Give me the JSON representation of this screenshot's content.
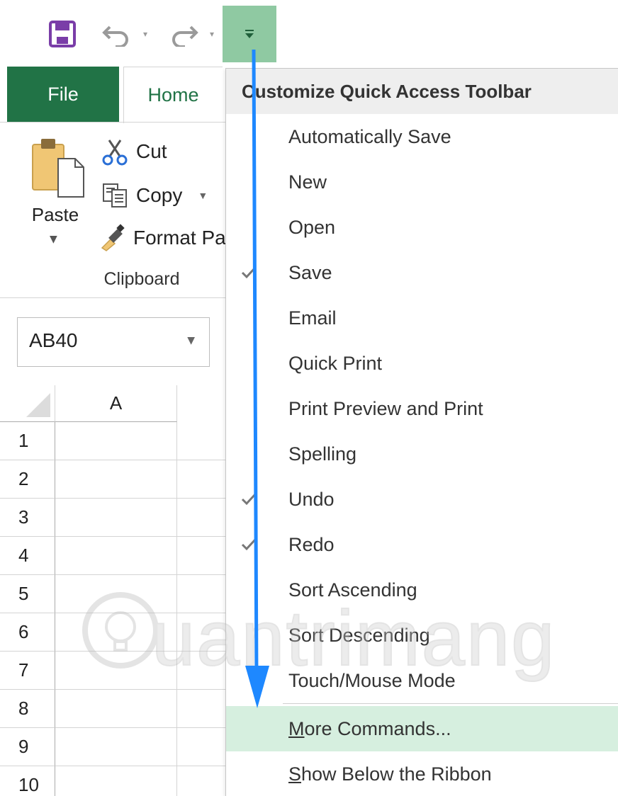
{
  "quick_access": {
    "save_icon": "save-floppy-icon",
    "undo_icon": "undo-icon",
    "redo_icon": "redo-icon",
    "customize_icon": "customize-qat-dropdown-icon"
  },
  "ribbon": {
    "tabs": [
      {
        "label": "File"
      },
      {
        "label": "Home"
      }
    ],
    "clipboard": {
      "paste_label": "Paste",
      "cut_label": "Cut",
      "copy_label": "Copy",
      "format_label": "Format Painter",
      "group_label": "Clipboard"
    }
  },
  "name_box": {
    "value": "AB40"
  },
  "sheet": {
    "columns": [
      "A"
    ],
    "rows": [
      "1",
      "2",
      "3",
      "4",
      "5",
      "6",
      "7",
      "8",
      "9",
      "10"
    ]
  },
  "menu": {
    "title": "Customize Quick Access Toolbar",
    "items": [
      {
        "label": "Automatically Save",
        "checked": false
      },
      {
        "label": "New",
        "checked": false
      },
      {
        "label": "Open",
        "checked": false
      },
      {
        "label": "Save",
        "checked": true
      },
      {
        "label": "Email",
        "checked": false
      },
      {
        "label": "Quick Print",
        "checked": false
      },
      {
        "label": "Print Preview and Print",
        "checked": false
      },
      {
        "label": "Spelling",
        "checked": false
      },
      {
        "label": "Undo",
        "checked": true
      },
      {
        "label": "Redo",
        "checked": true
      },
      {
        "label": "Sort Ascending",
        "checked": false
      },
      {
        "label": "Sort Descending",
        "checked": false
      },
      {
        "label": "Touch/Mouse Mode",
        "checked": false
      }
    ],
    "more_commands": {
      "mnemonic": "M",
      "rest": "ore Commands..."
    },
    "show_below": {
      "mnemonic": "S",
      "rest": "how Below the Ribbon"
    }
  },
  "watermark": {
    "text": "uantrimang"
  },
  "colors": {
    "file_tab": "#217346",
    "customize_button": "#8fc9a2",
    "menu_highlight": "#d6efdf",
    "arrow": "#1e88ff"
  }
}
